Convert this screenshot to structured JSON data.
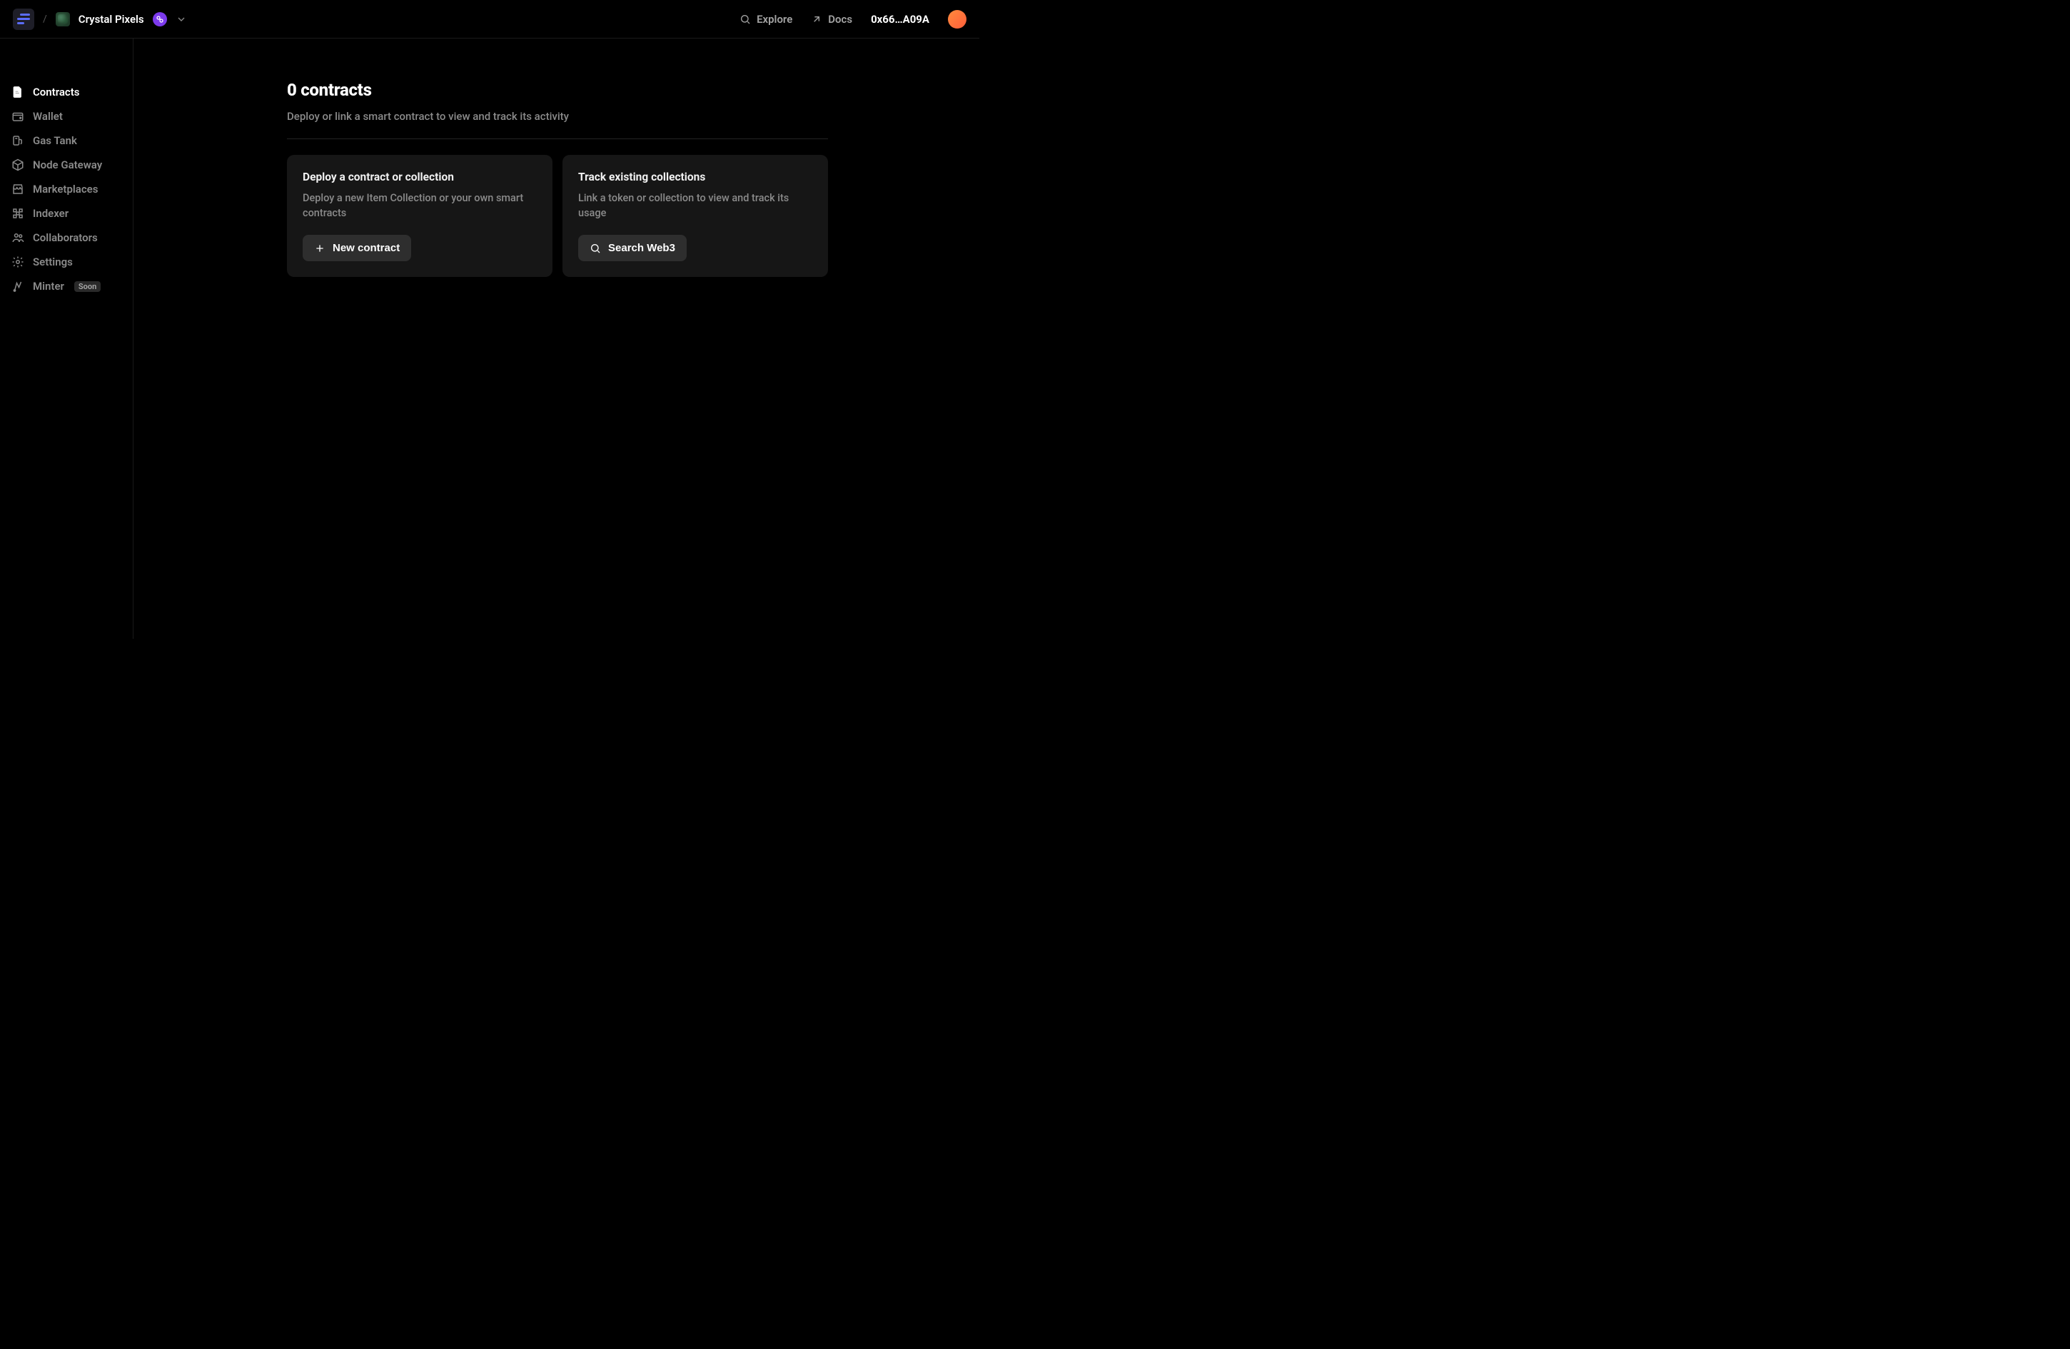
{
  "header": {
    "project_name": "Crystal Pixels",
    "explore_label": "Explore",
    "docs_label": "Docs",
    "wallet_address": "0x66…A09A"
  },
  "sidebar": {
    "items": [
      {
        "label": "Contracts",
        "icon": "document-icon",
        "active": true
      },
      {
        "label": "Wallet",
        "icon": "wallet-icon",
        "active": false
      },
      {
        "label": "Gas Tank",
        "icon": "fuel-icon",
        "active": false
      },
      {
        "label": "Node Gateway",
        "icon": "cube-icon",
        "active": false
      },
      {
        "label": "Marketplaces",
        "icon": "store-icon",
        "active": false
      },
      {
        "label": "Indexer",
        "icon": "grid-icon",
        "active": false
      },
      {
        "label": "Collaborators",
        "icon": "users-icon",
        "active": false
      },
      {
        "label": "Settings",
        "icon": "gear-icon",
        "active": false
      },
      {
        "label": "Minter",
        "icon": "minter-icon",
        "active": false,
        "badge": "Soon"
      }
    ]
  },
  "main": {
    "title": "0 contracts",
    "subtitle": "Deploy or link a smart contract to view and track its activity",
    "cards": [
      {
        "title": "Deploy a contract or collection",
        "description": "Deploy a new Item Collection or your own smart contracts",
        "button_label": "New contract",
        "button_icon": "plus-icon"
      },
      {
        "title": "Track existing collections",
        "description": "Link a token or collection to view and track its usage",
        "button_label": "Search Web3",
        "button_icon": "search-icon"
      }
    ]
  }
}
